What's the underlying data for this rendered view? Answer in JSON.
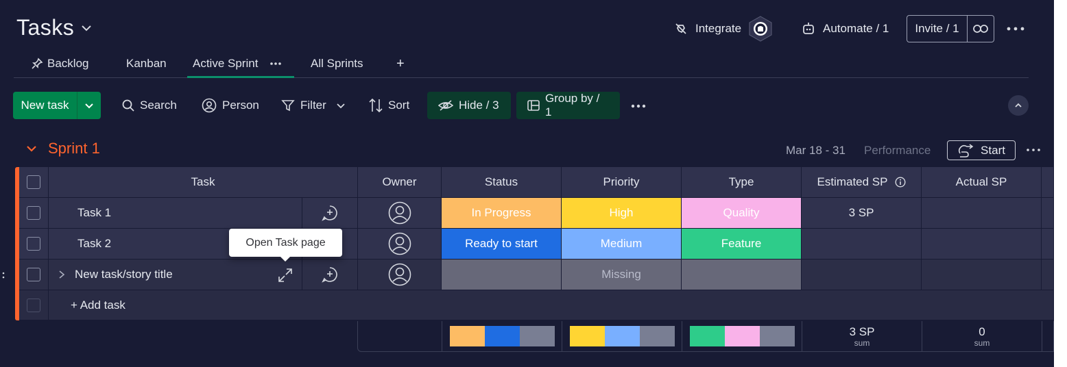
{
  "header": {
    "title": "Tasks",
    "integrate": "Integrate",
    "automate": "Automate / 1",
    "invite": "Invite / 1"
  },
  "tabs": [
    {
      "label": "Backlog"
    },
    {
      "label": "Kanban"
    },
    {
      "label": "Active Sprint"
    },
    {
      "label": "All Sprints"
    },
    {
      "label": "+"
    }
  ],
  "toolbar": {
    "new_task": "New task",
    "search": "Search",
    "person": "Person",
    "filter": "Filter",
    "sort": "Sort",
    "hide": "Hide / 3",
    "group_by": "Group by / 1"
  },
  "sprint": {
    "name": "Sprint 1",
    "dates": "Mar 18 - 31",
    "performance": "Performance",
    "start": "Start",
    "accent": "#ff642e"
  },
  "columns": {
    "task": "Task",
    "owner": "Owner",
    "status": "Status",
    "priority": "Priority",
    "type": "Type",
    "estimated_sp": "Estimated SP",
    "actual_sp": "Actual SP"
  },
  "rows": [
    {
      "task": "Task 1",
      "status": "In Progress",
      "status_color": "#fdbc64",
      "priority": "High",
      "priority_color": "#ffd533",
      "type": "Quality",
      "type_color": "#f9b2e9",
      "estimated_sp": "3 SP",
      "actual_sp": ""
    },
    {
      "task": "Task 2",
      "status": "Ready to start",
      "status_color": "#1f6de2",
      "priority": "Medium",
      "priority_color": "#79afff",
      "type": "Feature",
      "type_color": "#2ecc8a",
      "estimated_sp": "",
      "actual_sp": ""
    },
    {
      "task": "New task/story title",
      "status": "",
      "status_color": "#676879",
      "priority": "Missing",
      "priority_color": "#676879",
      "type": "",
      "type_color": "#676879",
      "estimated_sp": "",
      "actual_sp": ""
    }
  ],
  "add_task": "+ Add task",
  "tooltip": "Open Task page",
  "summary": {
    "status_colors": [
      "#fdbc64",
      "#1f6de2",
      "#797e93"
    ],
    "priority_colors": [
      "#ffd533",
      "#79afff",
      "#797e93"
    ],
    "type_colors": [
      "#2ecc8a",
      "#f9b2e9",
      "#797e93"
    ],
    "estimated": "3 SP",
    "estimated_label": "sum",
    "actual": "0",
    "actual_label": "sum"
  }
}
